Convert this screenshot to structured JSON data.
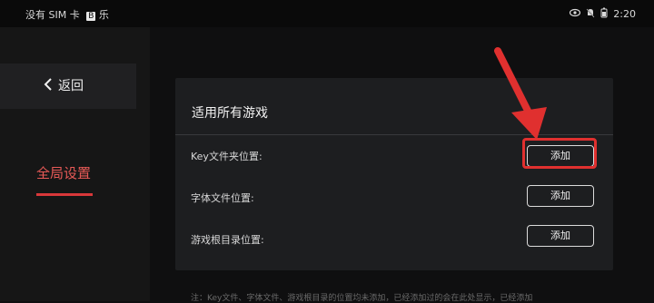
{
  "status": {
    "left_text": "没有 SIM 卡",
    "sim_badge": "B",
    "extra": "乐",
    "time": "2:20"
  },
  "sidebar": {
    "back_label": "返回",
    "global_settings": "全局设置"
  },
  "panel": {
    "title": "适用所有游戏",
    "rows": [
      {
        "label": "Key文件夹位置:",
        "button": "添加"
      },
      {
        "label": "字体文件位置:",
        "button": "添加"
      },
      {
        "label": "游戏根目录位置:",
        "button": "添加"
      }
    ]
  },
  "footer_note": "注：Key文件、字体文件、游戏根目录的位置均未添加，已经添加过的会在此处显示，已经添加",
  "colors": {
    "accent_red": "#e0302f",
    "selected_text": "#e85a57"
  }
}
